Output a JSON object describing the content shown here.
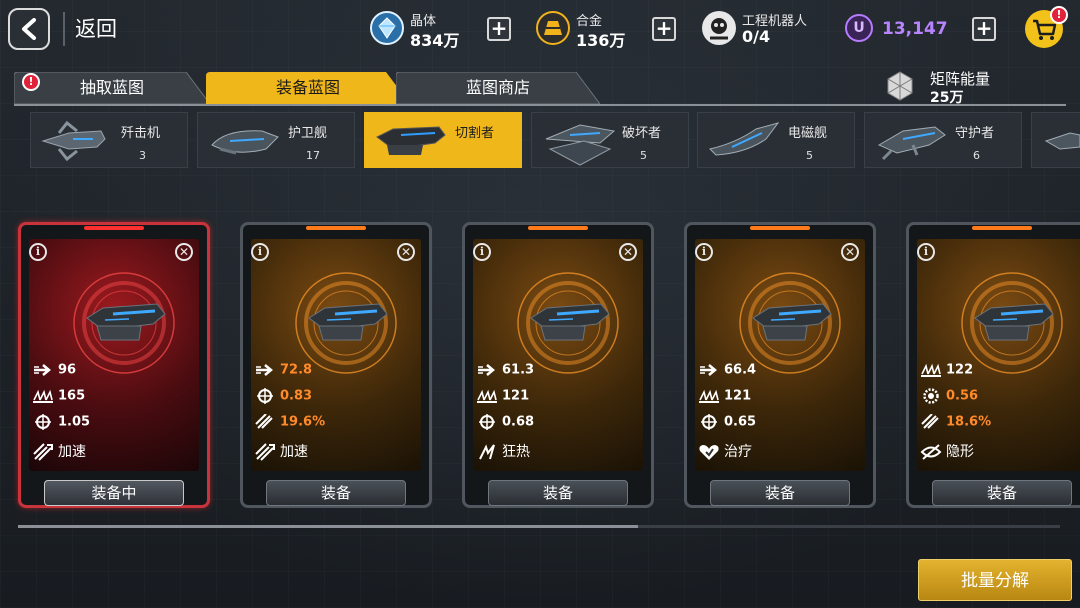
{
  "header": {
    "back_label": "返回",
    "resources": [
      {
        "name": "晶体",
        "value": "834万",
        "icon": "crystal-icon",
        "color": "#4fb3ff"
      },
      {
        "name": "合金",
        "value": "136万",
        "icon": "alloy-icon",
        "color": "#f2b21b"
      },
      {
        "name": "工程机器人",
        "value": "0/4",
        "icon": "robot-icon",
        "color": "#e6e6e6"
      }
    ],
    "premium_currency": {
      "icon": "u-coin-icon",
      "value": "13,147",
      "color": "#b883ff"
    },
    "shop_badge": "!"
  },
  "tabs": [
    {
      "label": "抽取蓝图",
      "active": false,
      "badge": "!"
    },
    {
      "label": "装备蓝图",
      "active": true
    },
    {
      "label": "蓝图商店",
      "active": false
    }
  ],
  "matrix_energy": {
    "label": "矩阵能量",
    "value": "25万"
  },
  "ship_types": [
    {
      "name": "歼击机",
      "count": "3"
    },
    {
      "name": "护卫舰",
      "count": "17"
    },
    {
      "name": "切割者",
      "count": "",
      "active": true
    },
    {
      "name": "破坏者",
      "count": "5"
    },
    {
      "name": "电磁舰",
      "count": "5"
    },
    {
      "name": "守护者",
      "count": "6"
    }
  ],
  "cards": [
    {
      "equipped": true,
      "button": "装备中",
      "stats": [
        {
          "icon": "speed-icon",
          "value": "96",
          "hl": false
        },
        {
          "icon": "armor-icon",
          "value": "165",
          "hl": false
        },
        {
          "icon": "targeting-icon",
          "value": "1.05",
          "hl": false
        }
      ],
      "skill": {
        "icon": "boost-icon",
        "label": "加速"
      }
    },
    {
      "equipped": false,
      "button": "装备",
      "stats": [
        {
          "icon": "speed-icon",
          "value": "72.8",
          "hl": true
        },
        {
          "icon": "targeting-icon",
          "value": "0.83",
          "hl": true
        },
        {
          "icon": "missile-icon",
          "value": "19.6%",
          "hl": true
        }
      ],
      "skill": {
        "icon": "boost-icon",
        "label": "加速"
      }
    },
    {
      "equipped": false,
      "button": "装备",
      "stats": [
        {
          "icon": "speed-icon",
          "value": "61.3",
          "hl": false
        },
        {
          "icon": "armor-icon",
          "value": "121",
          "hl": false
        },
        {
          "icon": "targeting-icon",
          "value": "0.68",
          "hl": false
        }
      ],
      "skill": {
        "icon": "frenzy-icon",
        "label": "狂热"
      }
    },
    {
      "equipped": false,
      "button": "装备",
      "stats": [
        {
          "icon": "speed-icon",
          "value": "66.4",
          "hl": false
        },
        {
          "icon": "armor-icon",
          "value": "121",
          "hl": false
        },
        {
          "icon": "targeting-icon",
          "value": "0.65",
          "hl": false
        }
      ],
      "skill": {
        "icon": "heal-icon",
        "label": "治疗"
      }
    },
    {
      "equipped": false,
      "button": "装备",
      "stats": [
        {
          "icon": "armor-icon",
          "value": "122",
          "hl": false
        },
        {
          "icon": "gear-icon",
          "value": "0.56",
          "hl": true
        },
        {
          "icon": "missile-icon",
          "value": "18.6%",
          "hl": true
        }
      ],
      "skill": {
        "icon": "stealth-icon",
        "label": "隐形"
      }
    }
  ],
  "bulk_button": "批量分解"
}
